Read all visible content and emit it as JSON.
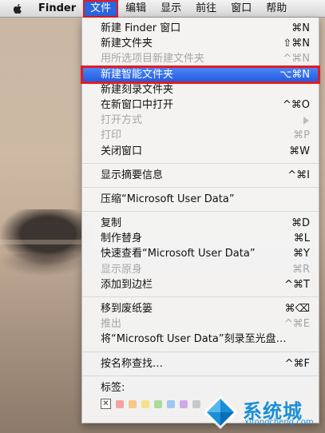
{
  "menubar": {
    "app": "Finder",
    "items": [
      "文件",
      "编辑",
      "显示",
      "前往",
      "窗口",
      "帮助"
    ]
  },
  "menu": {
    "items": [
      {
        "label": "新建 Finder 窗口",
        "shortcut": "⌘N",
        "disabled": false
      },
      {
        "label": "新建文件夹",
        "shortcut": "⇧⌘N",
        "disabled": false
      },
      {
        "label": "用所选项目新建文件夹",
        "shortcut": "^⌘N",
        "disabled": true
      },
      {
        "label": "新建智能文件夹",
        "shortcut": "⌥⌘N",
        "disabled": false,
        "highlighted": true
      },
      {
        "label": "新建刻录文件夹",
        "shortcut": "",
        "disabled": false
      },
      {
        "label": "在新窗口中打开",
        "shortcut": "^⌘O",
        "disabled": false
      },
      {
        "label": "打开方式",
        "shortcut": "",
        "disabled": true,
        "submenu": true
      },
      {
        "label": "打印",
        "shortcut": "⌘P",
        "disabled": true
      },
      {
        "label": "关闭窗口",
        "shortcut": "⌘W",
        "disabled": false
      },
      {
        "label": "显示摘要信息",
        "shortcut": "^⌘I",
        "disabled": false
      },
      {
        "label": "压缩“Microsoft User Data”",
        "shortcut": "",
        "disabled": false
      },
      {
        "label": "复制",
        "shortcut": "⌘D",
        "disabled": false
      },
      {
        "label": "制作替身",
        "shortcut": "⌘L",
        "disabled": false
      },
      {
        "label": "快速查看“Microsoft User Data”",
        "shortcut": "⌘Y",
        "disabled": false
      },
      {
        "label": "显示原身",
        "shortcut": "⌘R",
        "disabled": true
      },
      {
        "label": "添加到边栏",
        "shortcut": "^⌘T",
        "disabled": false
      },
      {
        "label": "移到废纸篓",
        "shortcut": "⌘⌫",
        "disabled": false
      },
      {
        "label": "推出",
        "shortcut": "^⌘E",
        "disabled": true
      },
      {
        "label": "将“Microsoft User Data”刻录至光盘…",
        "shortcut": "",
        "disabled": false
      },
      {
        "label": "按名称查找…",
        "shortcut": "^⌘F",
        "disabled": false
      },
      {
        "label": "标签:",
        "shortcut": "",
        "disabled": false
      }
    ],
    "tag_remove": "✕",
    "tag_colors": [
      "#f5a3a3",
      "#f8c889",
      "#f3e38a",
      "#a8dc9c",
      "#9ec5f3",
      "#d2a9e8",
      "#c8c8c8"
    ]
  },
  "watermark": {
    "name": "系统城",
    "url": "xitongcheng.com"
  }
}
